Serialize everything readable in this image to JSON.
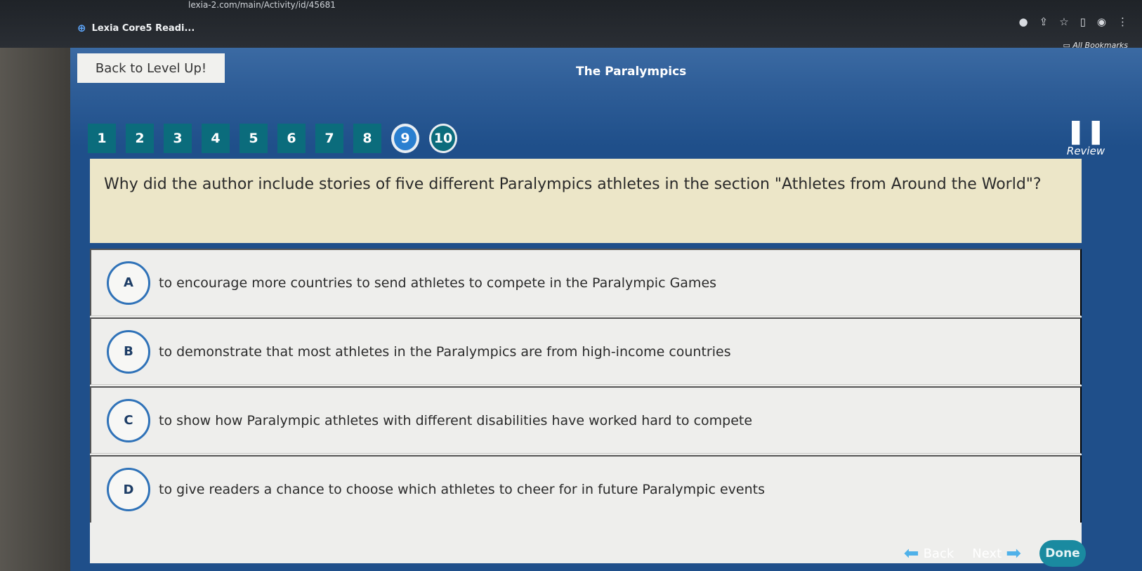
{
  "browser": {
    "url": "lexia-2.com/main/Activity/id/45681",
    "tab_title": "Lexia Core5 Readi...",
    "bookmarks_label": "All Bookmarks"
  },
  "header": {
    "back_label": "Back to Level Up!",
    "title": "The Paralympics"
  },
  "question_nav": [
    "1",
    "2",
    "3",
    "4",
    "5",
    "6",
    "7",
    "8",
    "9",
    "10"
  ],
  "review_label": "Review",
  "question": {
    "text": "Why did the author include stories of five different Paralympics athletes in the section \"Athletes from Around the World\"?"
  },
  "answers": [
    {
      "letter": "A",
      "text": "to encourage more countries to send athletes to compete in the Paralympic Games"
    },
    {
      "letter": "B",
      "text": "to demonstrate that most athletes in the Paralympics are from high-income countries"
    },
    {
      "letter": "C",
      "text": "to show how Paralympic athletes with different disabilities have worked hard to compete"
    },
    {
      "letter": "D",
      "text": "to give readers a chance to choose which athletes to cheer for in future Paralympic events"
    }
  ],
  "footer": {
    "back_label": "Back",
    "next_label": "Next",
    "done_label": "Done"
  }
}
